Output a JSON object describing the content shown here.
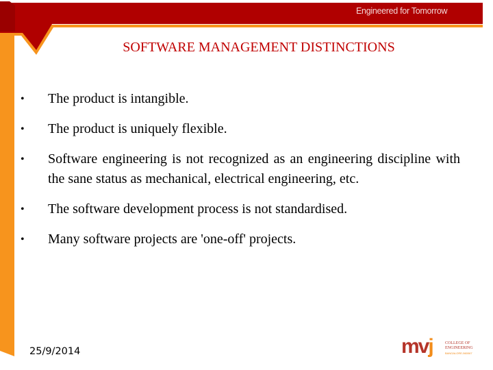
{
  "header": {
    "tagline": "Engineered for Tomorrow"
  },
  "slide": {
    "title": "SOFTWARE MANAGEMENT DISTINCTIONS",
    "bullets": [
      {
        "text": "The product is intangible."
      },
      {
        "text": "The product is uniquely flexible."
      },
      {
        "text": "Software engineering is not recognized as an engineering discipline with the sane status as mechanical, electrical engineering, etc."
      },
      {
        "text": "The software development process is not standardised."
      },
      {
        "text": "Many software projects are 'one-off' projects."
      }
    ],
    "bullet_glyph": "•"
  },
  "footer": {
    "date": "25/9/2014",
    "logo": {
      "mark_mv": "mv",
      "mark_j": "j",
      "line1": "COLLEGE OF",
      "line2": "ENGINEERING",
      "subtitle": "BANGALORE-560067"
    }
  },
  "colors": {
    "band_red": "#b00000",
    "accent_orange": "#f7941d",
    "title_red": "#c00000",
    "text": "#000000"
  }
}
